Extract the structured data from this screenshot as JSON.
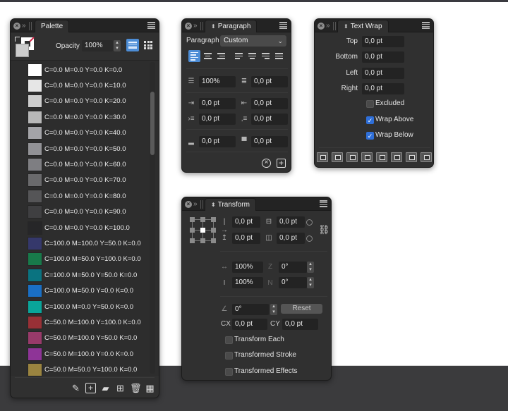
{
  "palette": {
    "tab": "Palette",
    "opacity_label": "Opacity",
    "opacity_value": "100%",
    "view_list_active": true,
    "swatches": [
      {
        "label": "C=0.0 M=0.0 Y=0.0 K=0.0",
        "color": "#ffffff"
      },
      {
        "label": "C=0.0 M=0.0 Y=0.0 K=10.0",
        "color": "#e6e6e6"
      },
      {
        "label": "C=0.0 M=0.0 Y=0.0 K=20.0",
        "color": "#cccccc"
      },
      {
        "label": "C=0.0 M=0.0 Y=0.0 K=30.0",
        "color": "#b8b8b8"
      },
      {
        "label": "C=0.0 M=0.0 Y=0.0 K=40.0",
        "color": "#a4a4a8"
      },
      {
        "label": "C=0.0 M=0.0 Y=0.0 K=50.0",
        "color": "#929296"
      },
      {
        "label": "C=0.0 M=0.0 Y=0.0 K=60.0",
        "color": "#7e7e82"
      },
      {
        "label": "C=0.0 M=0.0 Y=0.0 K=70.0",
        "color": "#6a6a6c"
      },
      {
        "label": "C=0.0 M=0.0 Y=0.0 K=80.0",
        "color": "#555557"
      },
      {
        "label": "C=0.0 M=0.0 Y=0.0 K=90.0",
        "color": "#3f3f41"
      },
      {
        "label": "C=0.0 M=0.0 Y=0.0 K=100.0",
        "color": "#262628"
      },
      {
        "label": "C=100.0 M=100.0 Y=50.0 K=0.0",
        "color": "#35386b"
      },
      {
        "label": "C=100.0 M=50.0 Y=100.0 K=0.0",
        "color": "#187a4a"
      },
      {
        "label": "C=100.0 M=50.0 Y=50.0 K=0.0",
        "color": "#0a7380"
      },
      {
        "label": "C=100.0 M=50.0 Y=0.0 K=0.0",
        "color": "#1a6fc4"
      },
      {
        "label": "C=100.0 M=0.0 Y=50.0 K=0.0",
        "color": "#0aa59a"
      },
      {
        "label": "C=50.0 M=100.0 Y=100.0 K=0.0",
        "color": "#983036"
      },
      {
        "label": "C=50.0 M=100.0 Y=50.0 K=0.0",
        "color": "#983a6a"
      },
      {
        "label": "C=50.0 M=100.0 Y=0.0 K=0.0",
        "color": "#8e3497"
      },
      {
        "label": "C=50.0 M=50.0 Y=100.0 K=0.0",
        "color": "#9a8440"
      }
    ],
    "footer_icons": [
      "edit-swatch-icon",
      "add-swatch-icon",
      "add-from-fill-icon",
      "grid-edit-icon",
      "trash-icon",
      "palette-options-icon"
    ]
  },
  "paragraph": {
    "tab": "Paragraph",
    "style_label": "Paragraph",
    "style_value": "Custom",
    "alignments": [
      "left",
      "center",
      "right",
      "justify-left",
      "justify-center",
      "justify-right",
      "justify-all"
    ],
    "active_alignment": "left",
    "line_spacing": "100%",
    "paragraph_spacing": "0,0 pt",
    "left_indent": "0,0 pt",
    "right_indent": "0,0 pt",
    "first_line_indent": "0,0 pt",
    "last_line_indent": "0,0 pt",
    "space_before": "0,0 pt",
    "space_after": "0,0 pt"
  },
  "text_wrap": {
    "tab": "Text Wrap",
    "top_label": "Top",
    "top_value": "0,0 pt",
    "bottom_label": "Bottom",
    "bottom_value": "0,0 pt",
    "left_label": "Left",
    "left_value": "0,0 pt",
    "right_label": "Right",
    "right_value": "0,0 pt",
    "excluded_label": "Excluded",
    "excluded_checked": false,
    "wrap_above_label": "Wrap Above",
    "wrap_above_checked": true,
    "wrap_below_label": "Wrap Below",
    "wrap_below_checked": true,
    "wrap_modes": [
      "wrap-top-left",
      "wrap-top",
      "wrap-box",
      "wrap-contour",
      "wrap-inside",
      "wrap-jump",
      "wrap-jump-next",
      "wrap-none"
    ]
  },
  "transform": {
    "tab": "Transform",
    "x": "0,0 pt",
    "y": "0,0 pt",
    "width": "0,0 pt",
    "height": "0,0 pt",
    "scale_x": "100%",
    "scale_y": "100%",
    "shear_x": "0°",
    "shear_y": "0°",
    "rotation": "0°",
    "reset_label": "Reset",
    "cx_label": "CX",
    "cx_value": "0,0 pt",
    "cy_label": "CY",
    "cy_value": "0,0 pt",
    "transform_each_label": "Transform Each",
    "transformed_stroke_label": "Transformed Stroke",
    "transformed_effects_label": "Transformed Effects"
  }
}
